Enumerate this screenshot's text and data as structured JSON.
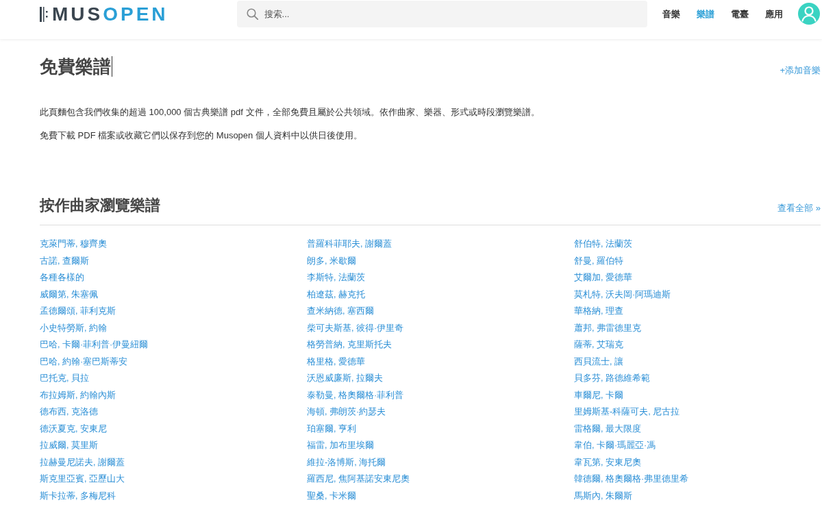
{
  "header": {
    "logo": {
      "part_1": "MUS",
      "part_2": "OPEN"
    },
    "search": {
      "placeholder": "搜索..."
    },
    "nav": [
      {
        "label": "音樂",
        "selected": false
      },
      {
        "label": "樂譜",
        "selected": true
      },
      {
        "label": "電臺",
        "selected": false
      },
      {
        "label": "應用",
        "selected": false
      }
    ]
  },
  "page": {
    "title": "免費樂譜",
    "add_link": "+添加音樂",
    "paragraphs": [
      "此頁麵包含我們收集的超過 100,000 個古典樂譜 pdf 文件，全部免費且屬於公共領域。依作曲家、樂器、形式或時段瀏覽樂譜。",
      "免費下載 PDF 檔案或收藏它們以保存到您的 Musopen 個人資料中以供日後使用。"
    ]
  },
  "composers": {
    "heading": "按作曲家瀏覽樂譜",
    "view_all": "查看全部 »",
    "columns": [
      [
        "克萊門蒂, 穆齊奧",
        "古諾, 查爾斯",
        "各種各樣的",
        "威爾第, 朱塞佩",
        "孟德爾頌, 菲利克斯",
        "小史特勞斯, 約翰",
        "巴哈, 卡爾·菲利普·伊曼紐爾",
        "巴哈, 約翰·塞巴斯蒂安",
        "巴托克, 貝拉",
        "布拉姆斯, 約翰內斯",
        "德布西, 克洛德",
        "德沃夏克, 安東尼",
        "拉威爾, 莫里斯",
        "拉赫曼尼諾夫, 謝爾蓋",
        "斯克里亞賓, 亞歷山大",
        "斯卡拉蒂, 多梅尼科"
      ],
      [
        "普羅科菲耶夫, 謝爾蓋",
        "朗多, 米歇爾",
        "李斯特, 法蘭茨",
        "柏遼茲, 赫克托",
        "查米納德, 塞西爾",
        "柴可夫斯基, 彼得·伊里奇",
        "格勞普納, 克里斯托夫",
        "格里格, 愛德華",
        "沃恩威廉斯, 拉爾夫",
        "泰勒曼, 格奧爾格·菲利普",
        "海頓, 弗朗茨·約瑟夫",
        "珀塞爾, 亨利",
        "福雷, 加布里埃爾",
        "維拉-洛博斯, 海托爾",
        "羅西尼, 焦阿基諾安東尼奧",
        "聖桑, 卡米爾"
      ],
      [
        "舒伯特, 法蘭茨",
        "舒曼, 羅伯特",
        "艾爾加, 愛德華",
        "莫札特, 沃夫岡·阿瑪迪斯",
        "華格納, 理查",
        "蕭邦, 弗雷德里克",
        "薩蒂, 艾瑞克",
        "西貝流士, 讓",
        "貝多芬, 路德維希範",
        "車爾尼, 卡爾",
        "里姆斯基-科薩可夫, 尼古拉",
        "雷格爾, 最大限度",
        "韋伯, 卡爾·瑪麗亞·馮",
        "韋瓦第, 安東尼奧",
        "韓德爾, 格奧爾格·弗里德里希",
        "馬斯內, 朱爾斯"
      ]
    ]
  }
}
